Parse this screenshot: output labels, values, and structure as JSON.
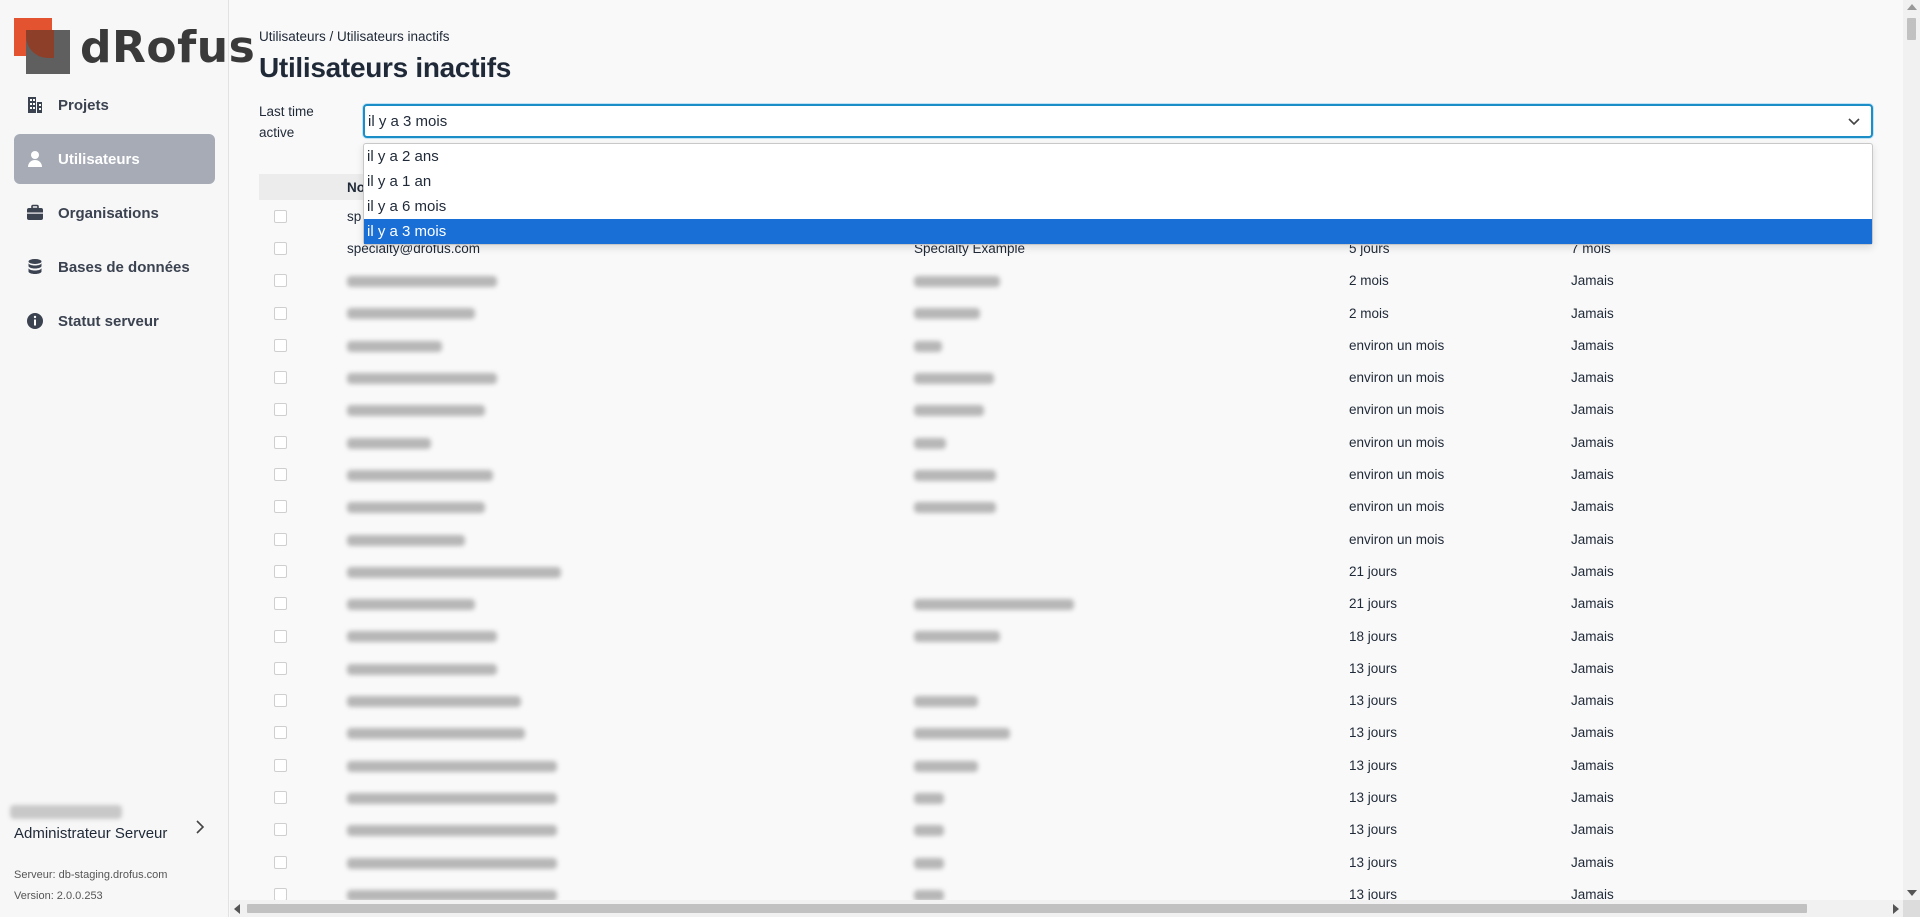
{
  "app": {
    "logo_text": "dRofus"
  },
  "sidebar": {
    "items": [
      {
        "label": "Projets",
        "icon": "building-icon",
        "active": false
      },
      {
        "label": "Utilisateurs",
        "icon": "user-icon",
        "active": true
      },
      {
        "label": "Organisations",
        "icon": "briefcase-icon",
        "active": false
      },
      {
        "label": "Bases de données",
        "icon": "database-icon",
        "active": false
      },
      {
        "label": "Statut serveur",
        "icon": "info-icon",
        "active": false
      }
    ],
    "user_role": "Administrateur Serveur",
    "server": "Serveur: db-staging.drofus.com",
    "version": "Version: 2.0.0.253"
  },
  "main": {
    "breadcrumb": "Utilisateurs / Utilisateurs inactifs",
    "title": "Utilisateurs inactifs",
    "filter_label": "Last time active",
    "select_value": "il y a 3 mois",
    "options": [
      "il y a 2 ans",
      "il y a 1 an",
      "il y a 6 mois",
      "il y a 3 mois"
    ],
    "selected_option": "il y a 3 mois"
  },
  "table": {
    "header_visible": "No",
    "rows": [
      {
        "email": "sp",
        "name": "",
        "last": "",
        "created": "",
        "blurred": false
      },
      {
        "email": "specialty@drofus.com",
        "name": "Specialty Example",
        "last": "5 jours",
        "created": "7 mois",
        "blurred": false
      },
      {
        "email": "",
        "name": "",
        "last": "2 mois",
        "created": "Jamais",
        "blurred": true
      },
      {
        "email": "",
        "name": "",
        "last": "2 mois",
        "created": "Jamais",
        "blurred": true
      },
      {
        "email": "",
        "name": "",
        "last": "environ un mois",
        "created": "Jamais",
        "blurred": true
      },
      {
        "email": "",
        "name": "",
        "last": "environ un mois",
        "created": "Jamais",
        "blurred": true
      },
      {
        "email": "",
        "name": "",
        "last": "environ un mois",
        "created": "Jamais",
        "blurred": true
      },
      {
        "email": "",
        "name": "",
        "last": "environ un mois",
        "created": "Jamais",
        "blurred": true
      },
      {
        "email": "",
        "name": "",
        "last": "environ un mois",
        "created": "Jamais",
        "blurred": true
      },
      {
        "email": "",
        "name": "",
        "last": "environ un mois",
        "created": "Jamais",
        "blurred": true
      },
      {
        "email": "",
        "name": "",
        "last": "environ un mois",
        "created": "Jamais",
        "blurred": true,
        "no_name": true
      },
      {
        "email": "",
        "name": "",
        "last": "21 jours",
        "created": "Jamais",
        "blurred": true,
        "no_name": true
      },
      {
        "email": "",
        "name": "",
        "last": "21 jours",
        "created": "Jamais",
        "blurred": true
      },
      {
        "email": "",
        "name": "",
        "last": "18 jours",
        "created": "Jamais",
        "blurred": true
      },
      {
        "email": "",
        "name": "",
        "last": "13 jours",
        "created": "Jamais",
        "blurred": true
      },
      {
        "email": "",
        "name": "",
        "last": "13 jours",
        "created": "Jamais",
        "blurred": true
      },
      {
        "email": "",
        "name": "",
        "last": "13 jours",
        "created": "Jamais",
        "blurred": true
      },
      {
        "email": "",
        "name": "",
        "last": "13 jours",
        "created": "Jamais",
        "blurred": true
      },
      {
        "email": "",
        "name": "",
        "last": "13 jours",
        "created": "Jamais",
        "blurred": true
      },
      {
        "email": "",
        "name": "",
        "last": "13 jours",
        "created": "Jamais",
        "blurred": true
      },
      {
        "email": "",
        "name": "",
        "last": "13 jours",
        "created": "Jamais",
        "blurred": true
      },
      {
        "email": "",
        "name": "",
        "last": "13 jours",
        "created": "Jamais",
        "blurred": true
      }
    ]
  },
  "colors": {
    "accent": "#1c8ec7",
    "selected_option": "#1a6fd6",
    "active_nav": "#a6abb6",
    "logo_orange": "#e4532f"
  }
}
